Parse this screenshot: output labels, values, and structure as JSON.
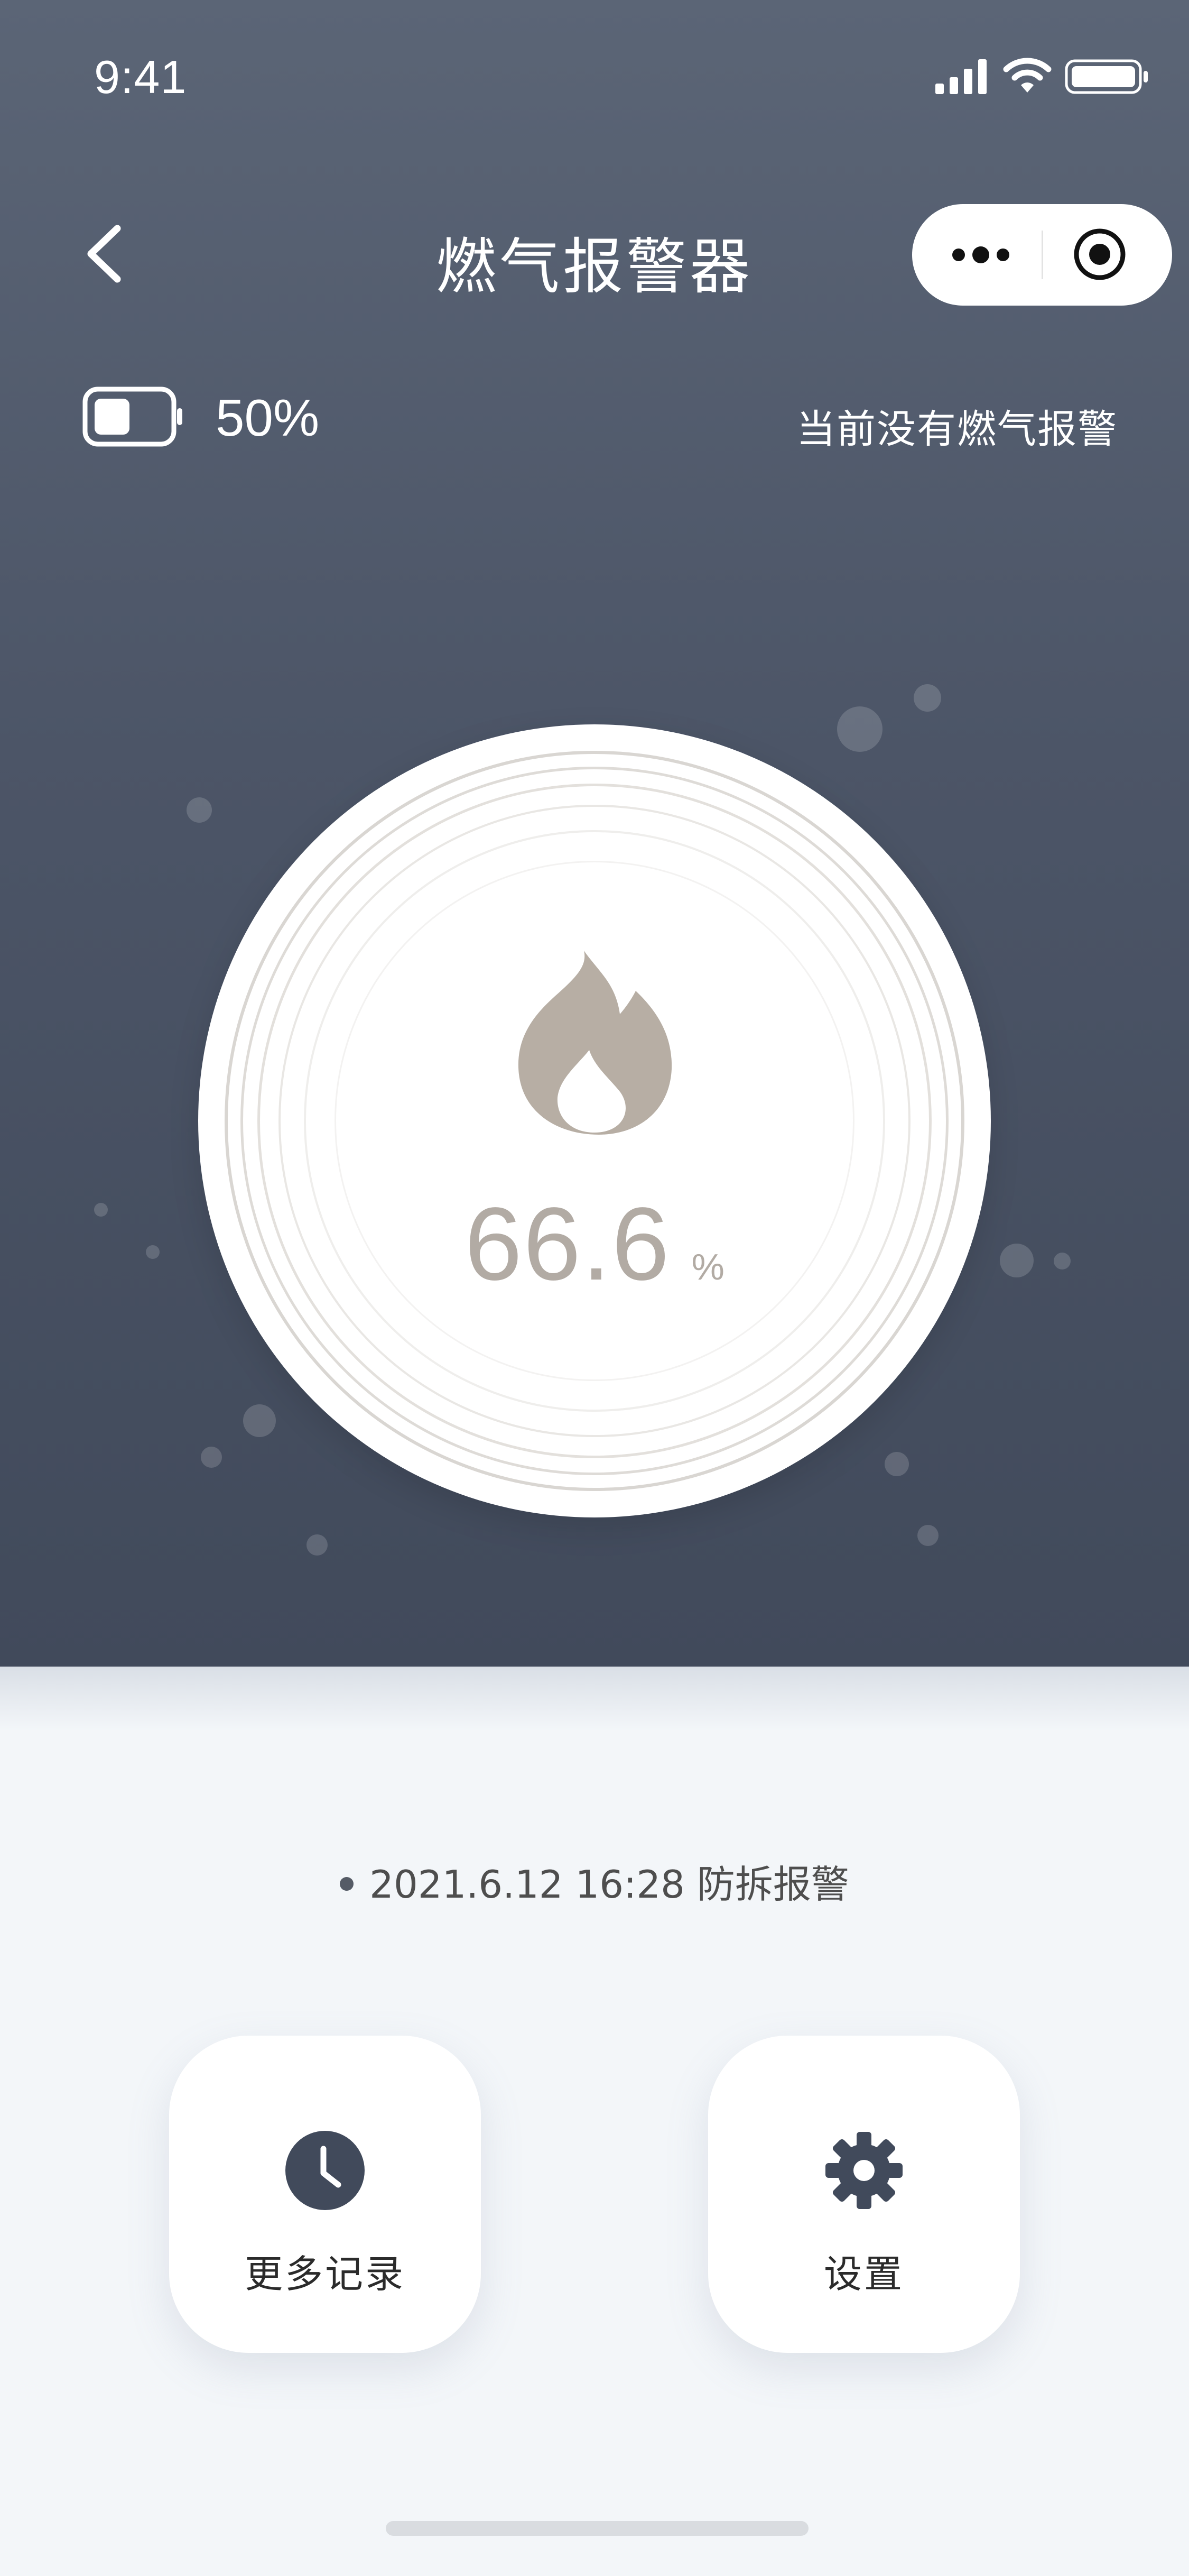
{
  "status_bar": {
    "time": "9:41"
  },
  "nav": {
    "title": "燃气报警器",
    "back_icon": "chevron-left-icon",
    "more_icon": "ellipsis-icon",
    "close_icon": "target-circle-icon"
  },
  "device": {
    "battery_percent": "50%",
    "battery_level": 0.5,
    "alarm_status": "当前没有燃气报警"
  },
  "gauge": {
    "icon": "flame-icon",
    "value": "66.6",
    "unit": "%"
  },
  "latest_record": {
    "text": "2021.6.12 16:28 防拆报警"
  },
  "actions": [
    {
      "label": "更多记录",
      "icon": "clock-icon"
    },
    {
      "label": "设置",
      "icon": "gear-icon"
    }
  ],
  "colors": {
    "header_top": "#5b6576",
    "header_bottom": "#414a5b",
    "page_background": "#f3f6f9",
    "gauge_text": "#b2aba4",
    "icon_dark": "#414a5b"
  }
}
